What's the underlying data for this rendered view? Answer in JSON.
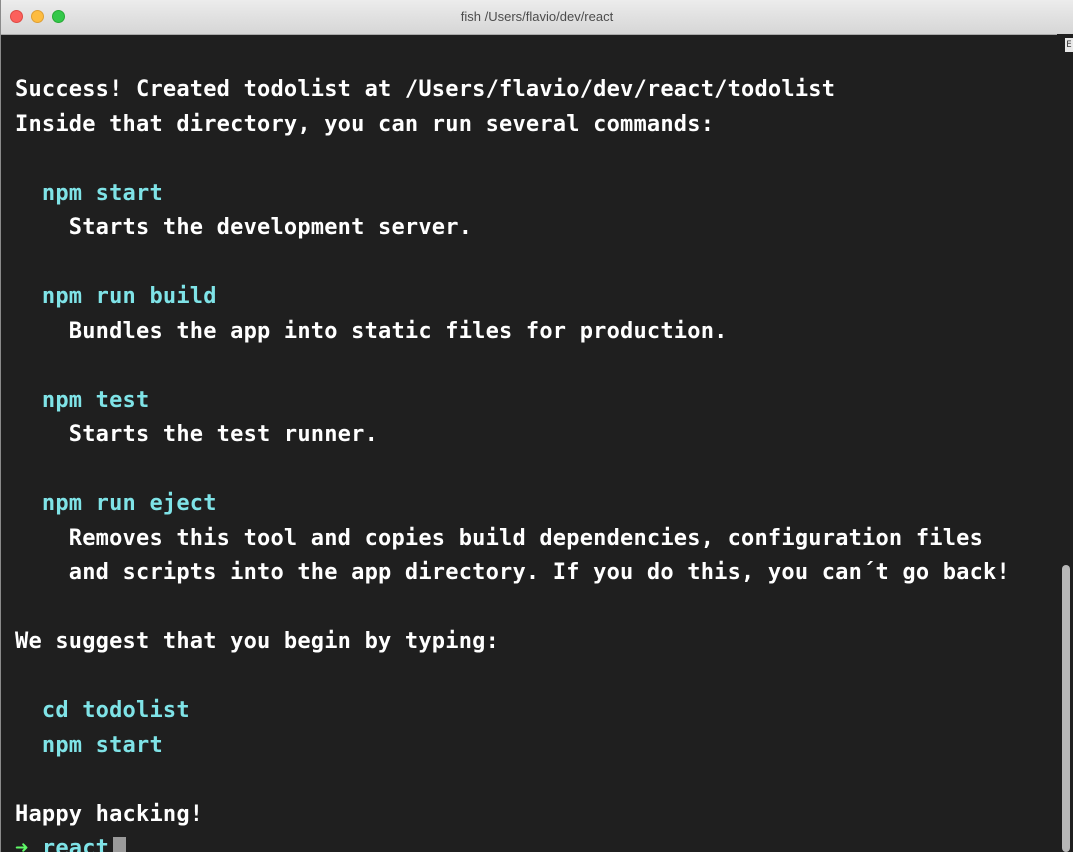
{
  "window": {
    "title": "fish  /Users/flavio/dev/react",
    "scroll_marker": "E"
  },
  "terminal": {
    "lines": {
      "l1": "Success! Created todolist at /Users/flavio/dev/react/todolist",
      "l2": "Inside that directory, you can run several commands:",
      "l3_cmd": "  npm start",
      "l4": "    Starts the development server.",
      "l5_cmd": "  npm run build",
      "l6": "    Bundles the app into static files for production.",
      "l7_cmd": "  npm test",
      "l8": "    Starts the test runner.",
      "l9_cmd": "  npm run eject",
      "l10": "    Removes this tool and copies build dependencies, configuration files",
      "l11": "    and scripts into the app directory. If you do this, you can´t go back!",
      "l12": "We suggest that you begin by typing:",
      "l13_cmd": "  cd todolist",
      "l14_cmd": "  npm start",
      "l15": "Happy hacking!"
    },
    "prompt": {
      "arrow": "➜",
      "dir": " react"
    }
  },
  "colors": {
    "background": "#1f1f1f",
    "text": "#ffffff",
    "command": "#7fe3e7",
    "prompt_arrow": "#5ff967"
  }
}
